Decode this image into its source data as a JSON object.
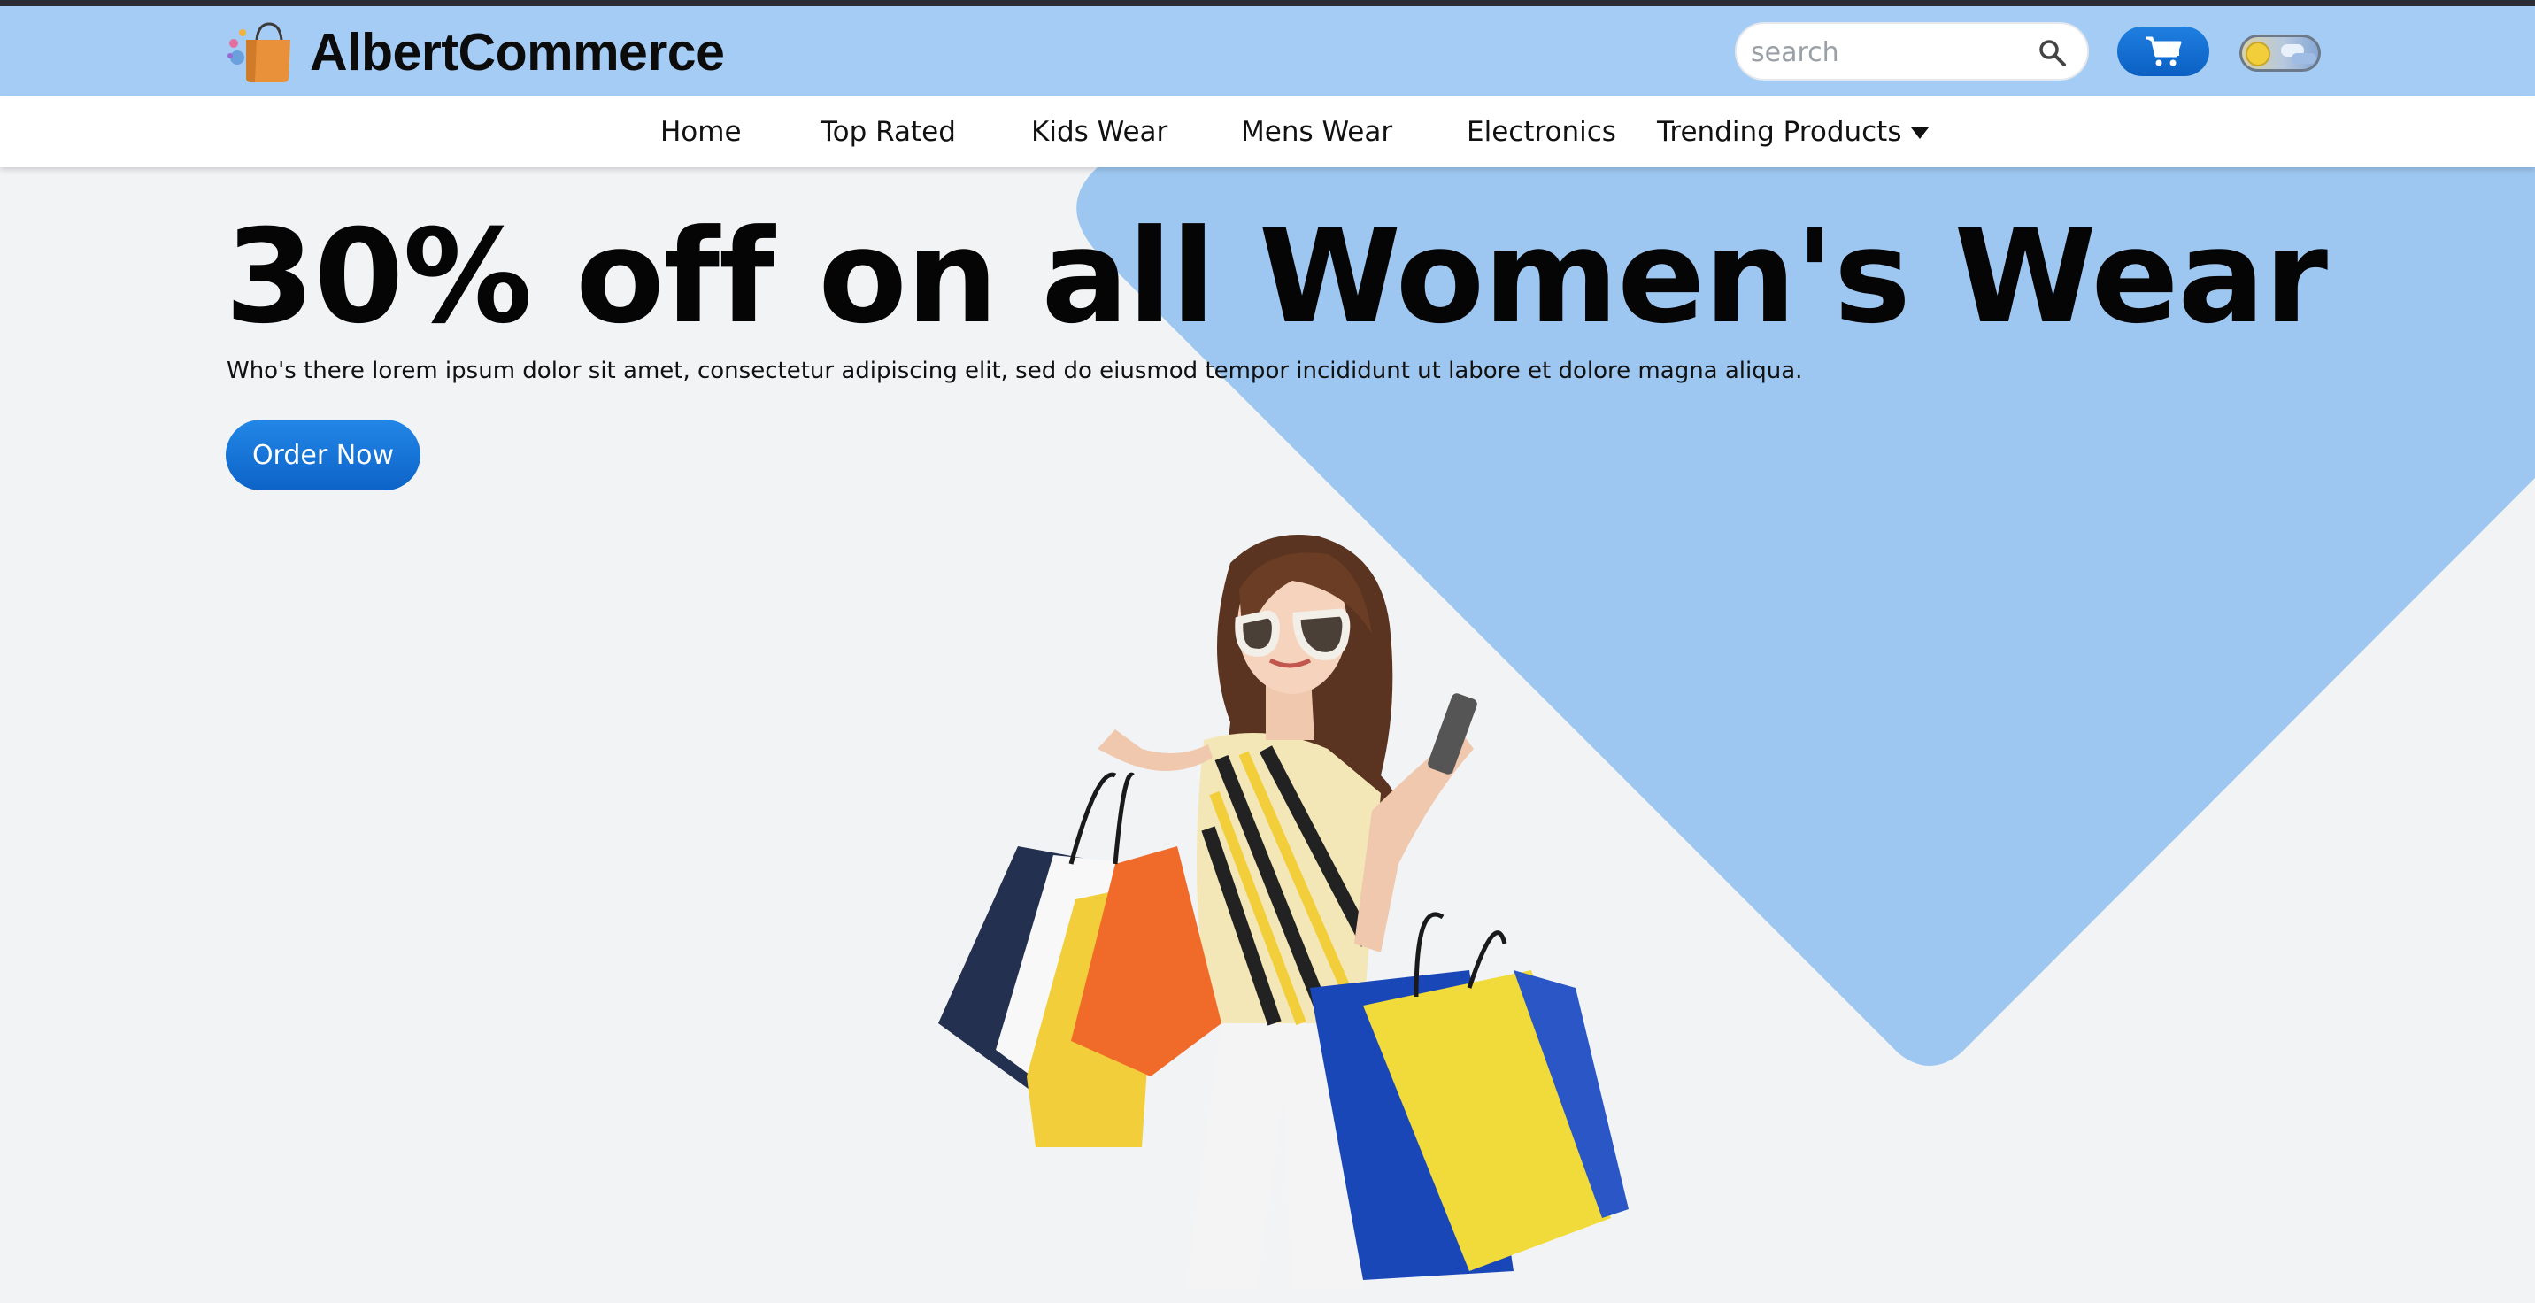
{
  "header": {
    "brand": "AlbertCommerce",
    "search_placeholder": "search"
  },
  "nav": {
    "items": [
      "Home",
      "Top Rated",
      "Kids Wear",
      "Mens Wear",
      "Electronics"
    ],
    "dropdown": "Trending Products"
  },
  "hero": {
    "title": "30% off on all Women's Wear",
    "subtitle": "Who's there lorem ipsum dolor sit amet, consectetur adipiscing elit, sed do eiusmod tempor incididunt ut labore et dolore magna aliqua.",
    "cta": "Order Now"
  },
  "icons": {
    "logo": "shopping-bag-logo-icon",
    "search": "search-icon",
    "cart": "cart-icon",
    "theme": "theme-toggle"
  },
  "colors": {
    "header_bg": "#a4ccf4",
    "accent": "#1f7fe0",
    "diamond": "#9dc7f0",
    "page_bg": "#f2f3f5"
  }
}
